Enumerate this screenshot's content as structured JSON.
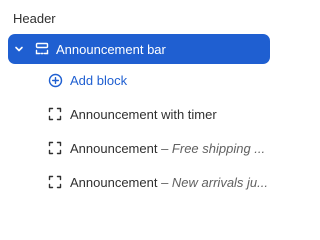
{
  "section": {
    "title": "Header"
  },
  "selected": {
    "label": "Announcement bar",
    "color": "#1f5fd1"
  },
  "add_block": {
    "label": "Add block",
    "color": "#1f5fd1"
  },
  "blocks": [
    {
      "title": "Announcement with timer",
      "subtitle": ""
    },
    {
      "title": "Announcement",
      "subtitle": "– Free shipping ..."
    },
    {
      "title": "Announcement",
      "subtitle": "– New arrivals ju..."
    }
  ],
  "icons": {
    "chevron": "chevron-down-icon",
    "section": "announcement-bar-icon",
    "add": "plus-circle-icon",
    "block": "block-frame-icon"
  }
}
